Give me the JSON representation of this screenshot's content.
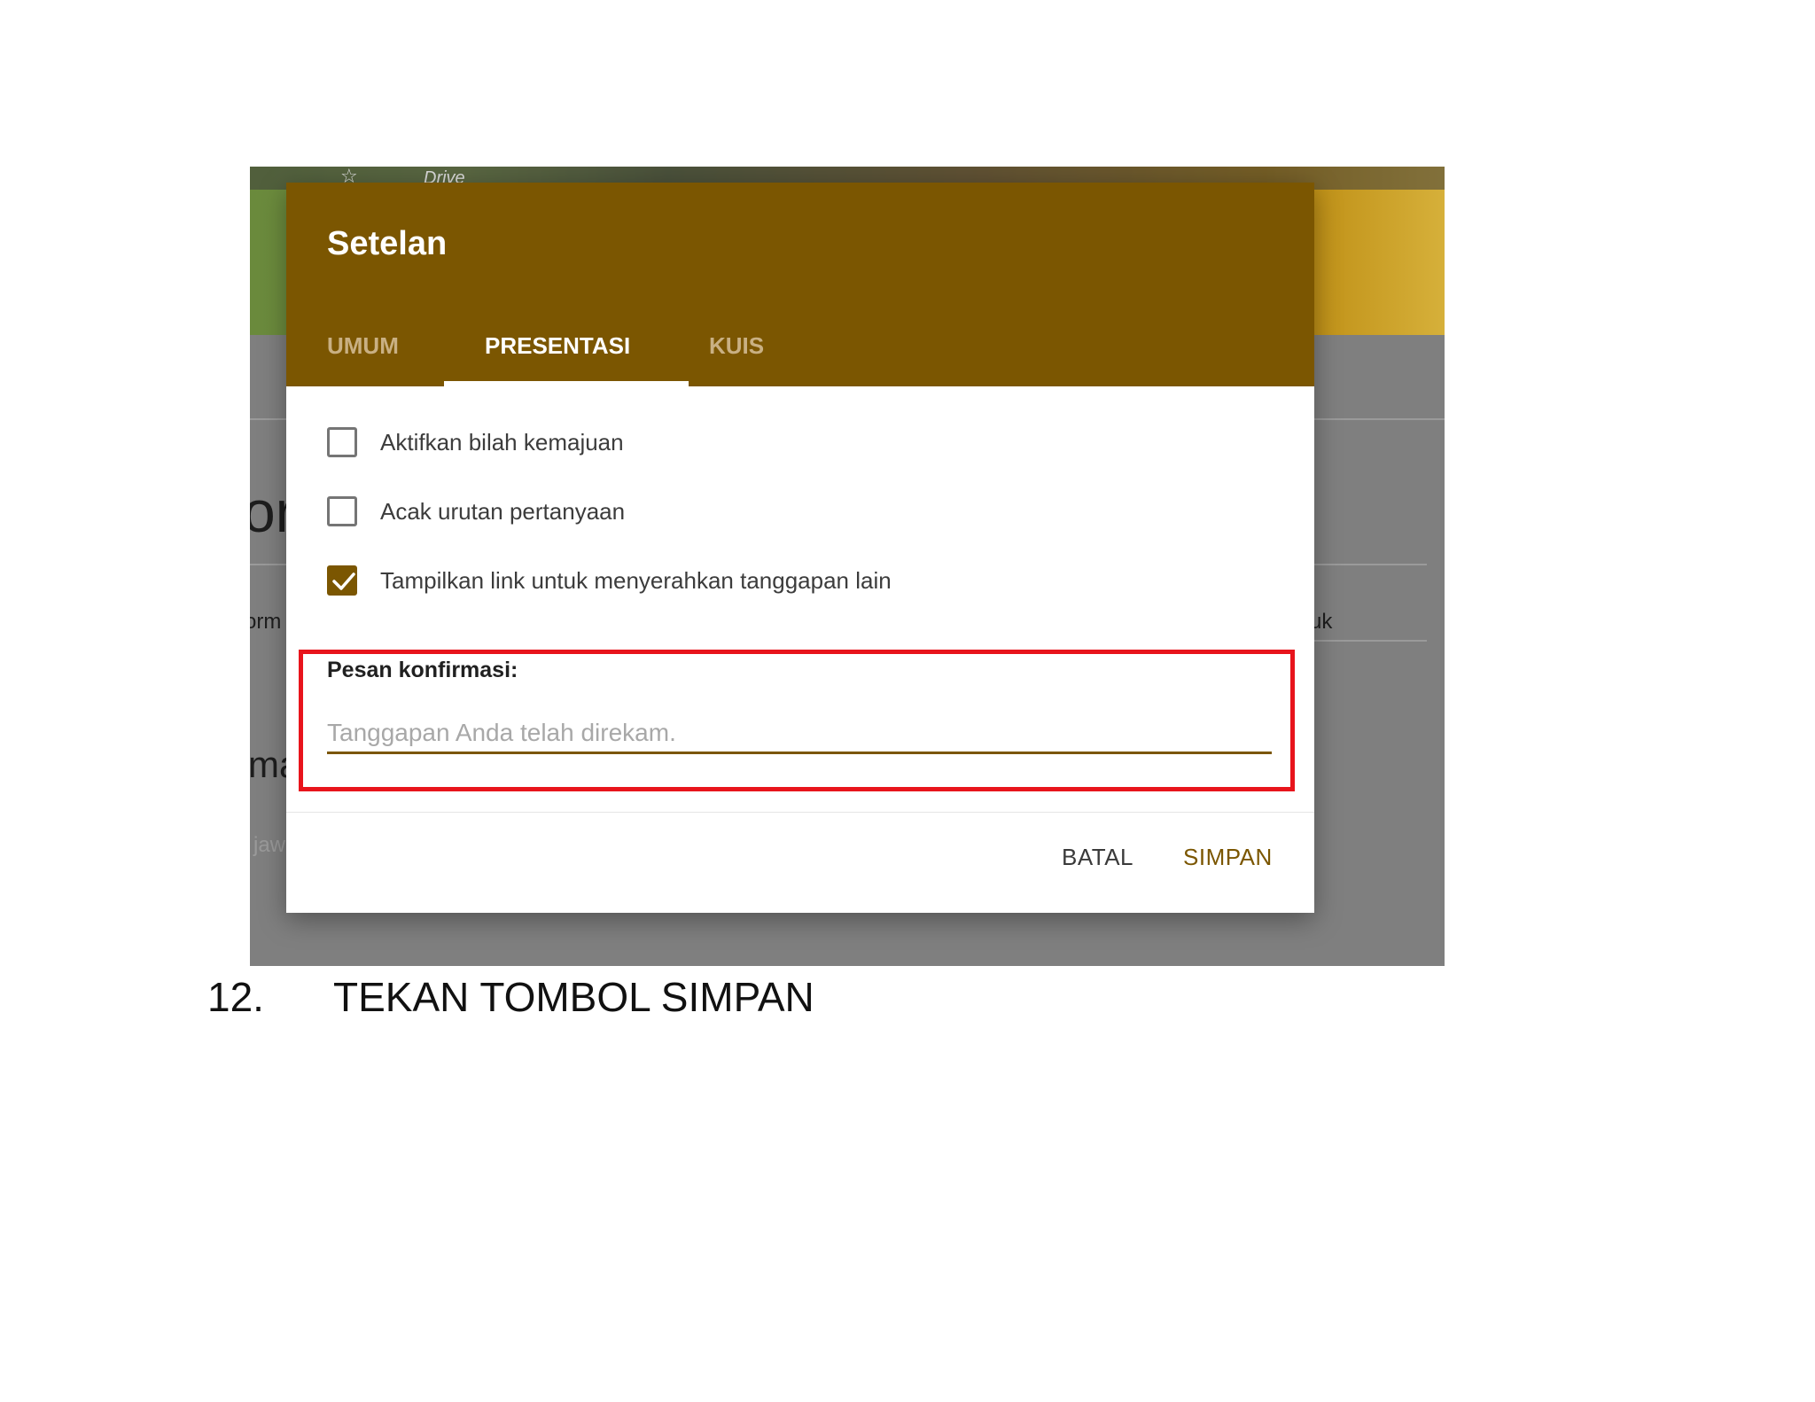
{
  "background": {
    "drive_label": "Drive",
    "fragments": {
      "or": "or",
      "orm": "orm",
      "ma": "ma",
      "jaw": "jaw",
      "uk": "uk"
    }
  },
  "dialog": {
    "title": "Setelan",
    "tabs": [
      {
        "label": "UMUM",
        "active": false
      },
      {
        "label": "PRESENTASI",
        "active": true
      },
      {
        "label": "KUIS",
        "active": false
      }
    ],
    "options": [
      {
        "label": "Aktifkan bilah kemajuan",
        "checked": false
      },
      {
        "label": "Acak urutan pertanyaan",
        "checked": false
      },
      {
        "label": "Tampilkan link untuk menyerahkan tanggapan lain",
        "checked": true
      }
    ],
    "confirmation": {
      "label": "Pesan konfirmasi:",
      "value": "",
      "placeholder": "Tanggapan Anda telah direkam."
    },
    "buttons": {
      "cancel": "BATAL",
      "save": "SIMPAN"
    }
  },
  "caption": {
    "number": "12.",
    "text": "TEKAN TOMBOL SIMPAN"
  },
  "colors": {
    "accent": "#7b5601",
    "highlight": "#e8141c"
  }
}
